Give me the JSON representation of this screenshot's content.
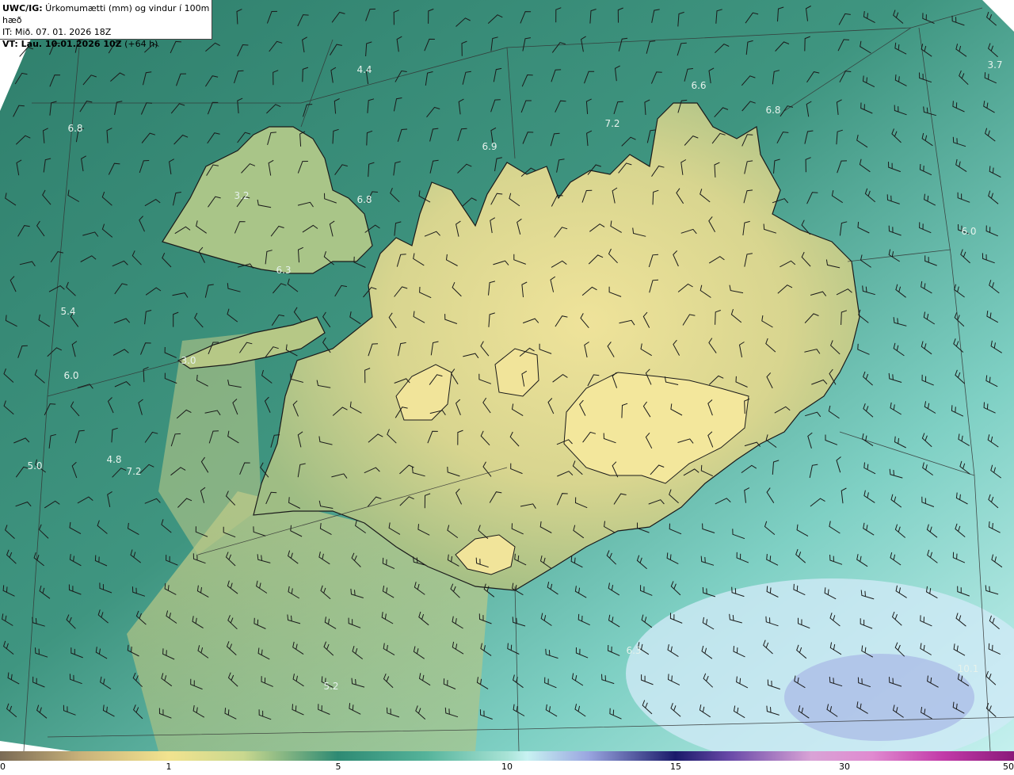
{
  "header": {
    "line1_bold": "UWC/IG:",
    "line1_rest": " Úrkomumætti (mm) og vindur í 100m hæð",
    "line2": "IT: Mið. 07. 01. 2026 18Z",
    "line3_bold": "VT: Lau. 10.01.2026 10Z",
    "line3_rest": " (+64 h)"
  },
  "colorbar": {
    "ticks": [
      "0",
      "1",
      "5",
      "10",
      "15",
      "30",
      "50"
    ]
  },
  "map": {
    "labels": [
      {
        "text": "4.4"
      },
      {
        "text": "6.6"
      },
      {
        "text": "3.7"
      },
      {
        "text": "6.8"
      },
      {
        "text": "7.2"
      },
      {
        "text": "6.8"
      },
      {
        "text": "6.9"
      },
      {
        "text": "3.2"
      },
      {
        "text": "6.8"
      },
      {
        "text": "6.0"
      },
      {
        "text": "6.3"
      },
      {
        "text": "5.4"
      },
      {
        "text": "3.0"
      },
      {
        "text": "6.0"
      },
      {
        "text": "5.0"
      },
      {
        "text": "4.8"
      },
      {
        "text": "7.2"
      },
      {
        "text": "5.2"
      },
      {
        "text": "10.1"
      },
      {
        "text": "6.3"
      }
    ],
    "colors": {
      "ocean_dark": "#2f7f6c",
      "ocean_mid": "#4fa58e",
      "ocean_light": "#b9ecea",
      "land_low": "#b7c987",
      "land_high": "#efe39a",
      "coast": "#1a1a1a",
      "barb": "#1a1a1a"
    }
  }
}
